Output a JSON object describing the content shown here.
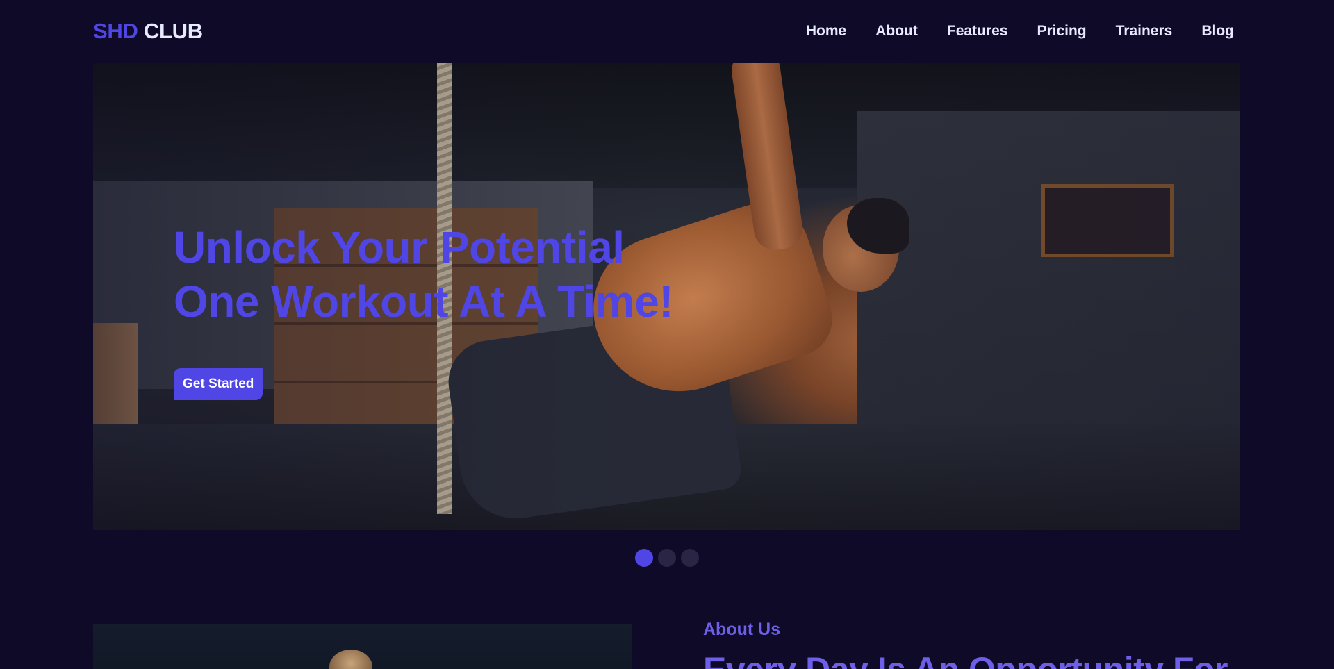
{
  "header": {
    "logo_brand": "SHD",
    "logo_name": "CLUB",
    "nav": [
      {
        "label": "Home"
      },
      {
        "label": "About"
      },
      {
        "label": "Features"
      },
      {
        "label": "Pricing"
      },
      {
        "label": "Trainers"
      },
      {
        "label": "Blog"
      }
    ]
  },
  "hero": {
    "title_line1": "Unlock Your Potential",
    "title_line2": "One Workout At A Time!",
    "cta_label": "Get Started",
    "image": "gym-athlete-stretch-photo",
    "slides_total": 3,
    "active_slide": 1
  },
  "about": {
    "label": "About Us",
    "heading": "Every Day Is An Opportunity For"
  },
  "colors": {
    "background": "#0f0a28",
    "accent": "#4f46e5",
    "nav_text": "#e8eaff",
    "about_accent": "#6d5fe8"
  }
}
